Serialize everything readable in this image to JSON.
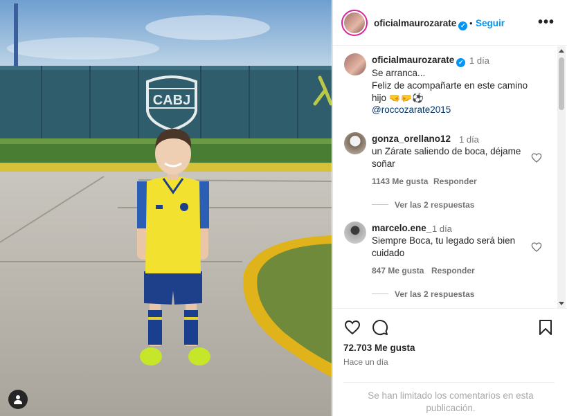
{
  "photo": {
    "sign_text": "CABJ"
  },
  "post": {
    "username": "oficialmaurozarate",
    "follow_label": "Seguir",
    "more_label": "•••",
    "dot": "•"
  },
  "caption": {
    "username": "oficialmaurozarate",
    "time": "1 día",
    "line1": "Se arranca...",
    "line2": "Feliz de acompañarte en este camino",
    "line3": "hijo 🤜🤛⚽",
    "mention": "@roccozarate2015"
  },
  "comments": [
    {
      "username": "gonza_orellano12",
      "time": "1 día",
      "text": "un Zárate saliendo de boca, déjame soñar",
      "likes": "1143 Me gusta",
      "reply": "Responder",
      "view_replies": "Ver las 2 respuestas"
    },
    {
      "username": "marcelo.ene_",
      "time": "1 día",
      "text": "Siempre Boca, tu legado será bien cuidado",
      "likes": "847 Me gusta",
      "reply": "Responder",
      "view_replies": "Ver las 2 respuestas"
    }
  ],
  "footer": {
    "likes": "72.703 Me gusta",
    "time": "Hace un día",
    "limited_notice": "Se han limitado los comentarios en esta publicación."
  }
}
